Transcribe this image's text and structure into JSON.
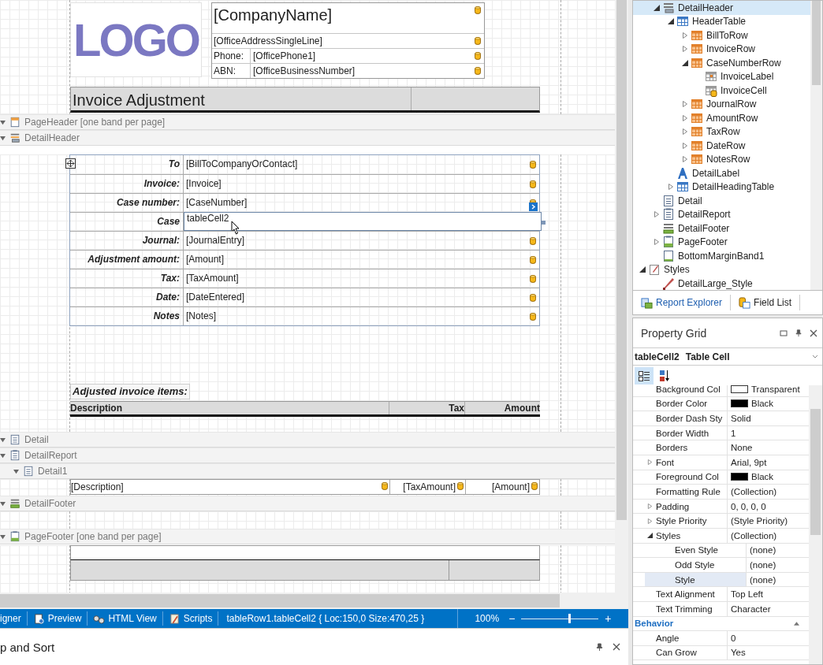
{
  "canvas": {
    "header": {
      "logo": "LOGO",
      "company_name": "[CompanyName]",
      "address": "[OfficeAddressSingleLine]",
      "address_bound": true,
      "company_bound": true,
      "contacts": [
        {
          "label": "Phone:",
          "value": "[OfficePhone1]",
          "bound": true
        },
        {
          "label": "ABN:",
          "value": "[OfficeBusinessNumber]",
          "bound": true
        }
      ],
      "title": "Invoice Adjustment"
    },
    "bands": [
      {
        "kind": "page-header",
        "label": "PageHeader [one band per page]",
        "expanded": true
      },
      {
        "kind": "detail-header",
        "label": "DetailHeader",
        "expanded": true
      },
      {
        "kind": "detail",
        "label": "Detail",
        "expanded": true
      },
      {
        "kind": "detail-report",
        "label": "DetailReport",
        "expanded": true,
        "children": [
          {
            "kind": "detail",
            "label": "Detail1",
            "expanded": true
          }
        ]
      },
      {
        "kind": "detail-footer",
        "label": "DetailFooter",
        "expanded": true
      },
      {
        "kind": "page-footer",
        "label": "PageFooter [one band per page]",
        "expanded": true
      }
    ],
    "fields": [
      {
        "label": "To",
        "value": "[BillToCompanyOrContact]",
        "bound": true,
        "selected": false
      },
      {
        "label": "Invoice:",
        "value": "[Invoice]",
        "bound": true,
        "selected": false
      },
      {
        "label": "Case number:",
        "value": "[CaseNumber]",
        "bound": true,
        "selected": false
      },
      {
        "label": "Case",
        "value": "tableCell2",
        "bound": false,
        "selected": true
      },
      {
        "label": "Journal:",
        "value": "[JournalEntry]",
        "bound": true,
        "selected": false
      },
      {
        "label": "Adjustment amount:",
        "value": "[Amount]",
        "bound": true,
        "selected": false
      },
      {
        "label": "Tax:",
        "value": "[TaxAmount]",
        "bound": true,
        "selected": false
      },
      {
        "label": "Date:",
        "value": "[DateEntered]",
        "bound": true,
        "selected": false
      },
      {
        "label": "Notes",
        "value": "[Notes]",
        "bound": true,
        "selected": false
      }
    ],
    "items_caption": "Adjusted invoice items:",
    "items_columns": [
      "Description",
      "Tax",
      "Amount"
    ],
    "items_row": [
      {
        "value": "[Description]",
        "bound": true
      },
      {
        "value": "[TaxAmount]",
        "bound": true
      },
      {
        "value": "[Amount]",
        "bound": true
      }
    ]
  },
  "status_bar": {
    "tabs": [
      {
        "label": "igner"
      },
      {
        "label": "Preview",
        "kind": "preview"
      },
      {
        "label": "HTML View",
        "kind": "html"
      },
      {
        "label": "Scripts",
        "kind": "scripts"
      }
    ],
    "selection": "tableRow1.tableCell2 { Loc:150,0 Size:470,25 }",
    "zoom": "100%",
    "zoom_minus": "−",
    "zoom_plus": "+",
    "zoom_slider": {
      "level": 0.62
    }
  },
  "bottom_panel": {
    "title": "p and Sort"
  },
  "report_explorer": {
    "tree": [
      {
        "children": [
          {
            "label": "DetailHeader",
            "kind": "band-header",
            "expandable": true,
            "expanded": true,
            "selected": true,
            "children": [
              {
                "label": "HeaderTable",
                "kind": "table",
                "expandable": true,
                "expanded": true,
                "selected": false,
                "children": [
                  {
                    "label": "BillToRow",
                    "kind": "row",
                    "expandable": true,
                    "expanded": false,
                    "selected": false
                  },
                  {
                    "label": "InvoiceRow",
                    "kind": "row",
                    "expandable": true,
                    "expanded": false,
                    "selected": false
                  },
                  {
                    "label": "CaseNumberRow",
                    "kind": "row",
                    "expandable": true,
                    "expanded": true,
                    "selected": false,
                    "children": [
                      {
                        "label": "InvoiceLabel",
                        "kind": "label-cell",
                        "expandable": false,
                        "selected": false
                      },
                      {
                        "label": "InvoiceCell",
                        "kind": "data-cell",
                        "expandable": false,
                        "selected": false
                      }
                    ]
                  },
                  {
                    "label": "JournalRow",
                    "kind": "row",
                    "expandable": true,
                    "expanded": false,
                    "selected": false
                  },
                  {
                    "label": "AmountRow",
                    "kind": "row",
                    "expandable": true,
                    "expanded": false,
                    "selected": false
                  },
                  {
                    "label": "TaxRow",
                    "kind": "row",
                    "expandable": true,
                    "expanded": false,
                    "selected": false
                  },
                  {
                    "label": "DateRow",
                    "kind": "row",
                    "expandable": true,
                    "expanded": false,
                    "selected": false
                  },
                  {
                    "label": "NotesRow",
                    "kind": "row",
                    "expandable": true,
                    "expanded": false,
                    "selected": false
                  }
                ]
              },
              {
                "label": "DetailLabel",
                "kind": "label",
                "expandable": false,
                "selected": false
              },
              {
                "label": "DetailHeadingTable",
                "kind": "table",
                "expandable": true,
                "expanded": false,
                "selected": false
              }
            ]
          },
          {
            "label": "Detail",
            "kind": "detail",
            "expandable": false,
            "selected": false
          },
          {
            "label": "DetailReport",
            "kind": "detail-report",
            "expandable": true,
            "expanded": false,
            "selected": false
          },
          {
            "label": "DetailFooter",
            "kind": "detail-footer",
            "expandable": false,
            "selected": false
          },
          {
            "label": "PageFooter",
            "kind": "page-footer",
            "expandable": true,
            "expanded": false,
            "selected": false
          },
          {
            "label": "BottomMarginBand1",
            "kind": "bottom-margin",
            "expandable": false,
            "selected": false
          }
        ]
      },
      {
        "label": "Styles",
        "kind": "styles",
        "expandable": true,
        "expanded": true,
        "selected": false,
        "children": [
          {
            "label": "DetailLarge_Style",
            "kind": "style",
            "expandable": false,
            "selected": false
          }
        ]
      }
    ],
    "tabs": [
      {
        "label": "Report Explorer",
        "kind": "report-explorer",
        "selected": true
      },
      {
        "label": "Field List",
        "kind": "field-list",
        "selected": false
      }
    ]
  },
  "property_grid": {
    "title": "Property Grid",
    "object_name": "tableCell2",
    "object_type": "Table Cell",
    "view_modes": [
      {
        "kind": "categorized",
        "selected": true
      },
      {
        "kind": "alphabetical",
        "selected": false
      }
    ],
    "rows": [
      {
        "name": "Background Col",
        "value": "Transparent",
        "color": "#ffffff",
        "expandable": false,
        "selected": false
      },
      {
        "name": "Border Color",
        "value": "Black",
        "color": "#000000",
        "expandable": false,
        "selected": false
      },
      {
        "name": "Border Dash Sty",
        "value": "Solid",
        "expandable": false,
        "selected": false
      },
      {
        "name": "Border Width",
        "value": "1",
        "expandable": false,
        "selected": false
      },
      {
        "name": "Borders",
        "value": "None",
        "expandable": false,
        "selected": false
      },
      {
        "name": "Font",
        "value": "Arial, 9pt",
        "expandable": true,
        "expanded": false,
        "selected": false
      },
      {
        "name": "Foreground Col",
        "value": "Black",
        "color": "#000000",
        "expandable": false,
        "selected": false
      },
      {
        "name": "Formatting Rule",
        "value": "(Collection)",
        "expandable": false,
        "selected": false
      },
      {
        "name": "Padding",
        "value": "0, 0, 0, 0",
        "expandable": true,
        "expanded": false,
        "selected": false
      },
      {
        "name": "Style Priority",
        "value": "(Style Priority)",
        "expandable": true,
        "expanded": false,
        "selected": false
      },
      {
        "name": "Styles",
        "value": "(Collection)",
        "expandable": true,
        "expanded": true,
        "selected": false,
        "children": [
          {
            "name": "Even Style",
            "value": "(none)",
            "expandable": false,
            "selected": false
          },
          {
            "name": "Odd Style",
            "value": "(none)",
            "expandable": false,
            "selected": false
          },
          {
            "name": "Style",
            "value": "(none)",
            "expandable": false,
            "selected": true
          }
        ]
      },
      {
        "name": "Text Alignment",
        "value": "Top Left",
        "expandable": false,
        "selected": false
      },
      {
        "name": "Text Trimming",
        "value": "Character",
        "expandable": false,
        "selected": false
      }
    ],
    "categories": [
      {
        "name": "Behavior",
        "expanded": true,
        "rows": [
          {
            "name": "Angle",
            "value": "0",
            "expandable": false,
            "selected": false
          },
          {
            "name": "Can Grow",
            "value": "Yes",
            "expandable": false,
            "selected": false
          }
        ]
      }
    ]
  }
}
